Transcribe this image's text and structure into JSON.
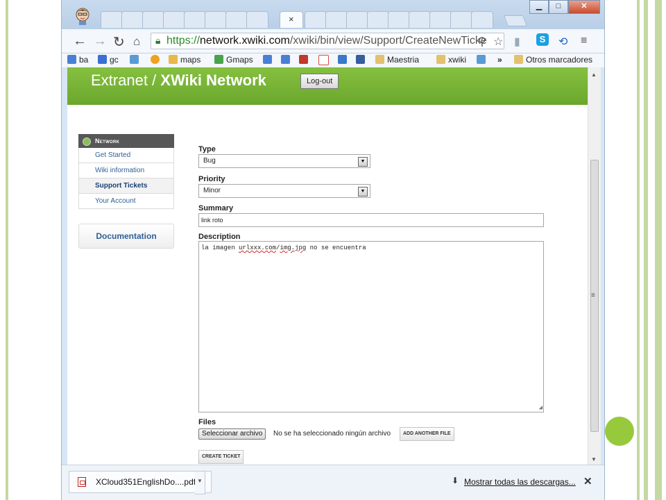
{
  "browser": {
    "url_scheme": "https://",
    "url_host": "network.xwiki.com",
    "url_path": "/xwiki/bin/view/Support/CreateNewTicke",
    "tab_close": "×",
    "window_buttons": {
      "minimize": "▁",
      "maximize": "□",
      "close": "✕"
    }
  },
  "bookmarks": [
    {
      "label": "ba",
      "icon": "google-icon",
      "color": "#4a7fd6"
    },
    {
      "label": "gc",
      "icon": "calendar-icon",
      "color": "#3d6fd1"
    },
    {
      "label": "",
      "icon": "photo-icon",
      "color": "#5b9bd5"
    },
    {
      "label": "",
      "icon": "pie-icon",
      "color": "#f0a020"
    },
    {
      "label": "maps",
      "icon": "maps-icon",
      "color": "#e8b84a"
    },
    {
      "label": "Gmaps",
      "icon": "gmaps-icon",
      "color": "#49a34d"
    },
    {
      "label": "",
      "icon": "translate-icon",
      "color": "#4a7fd6"
    },
    {
      "label": "",
      "icon": "translate2-icon",
      "color": "#4a7fd6"
    },
    {
      "label": "",
      "icon": "plus-icon",
      "color": "#c0392b"
    },
    {
      "label": "",
      "icon": "gmail-icon",
      "color": "#d64c3c"
    },
    {
      "label": "",
      "icon": "windows-icon",
      "color": "#3a78c9"
    },
    {
      "label": "",
      "icon": "fn-icon",
      "color": "#355e9e"
    },
    {
      "label": "Maestria",
      "icon": "folder-icon",
      "color": "#e3c170"
    },
    {
      "label": "xwiki",
      "icon": "folder-icon",
      "color": "#e3c170"
    },
    {
      "label": "",
      "icon": "chart-icon",
      "color": "#5b9bd5"
    },
    {
      "label": "»",
      "icon": "",
      "color": ""
    },
    {
      "label": "Otros marcadores",
      "icon": "folder-icon",
      "color": "#e3c170"
    }
  ],
  "site": {
    "title_prefix": "Extranet / ",
    "title_main": "XWiki Network",
    "logout_label": "Log-out"
  },
  "sidebar": {
    "header": "Network",
    "items": [
      {
        "label": "Get Started",
        "active": false
      },
      {
        "label": "Wiki information",
        "active": false
      },
      {
        "label": "Support Tickets",
        "active": true
      },
      {
        "label": "Your Account",
        "active": false
      }
    ],
    "documentation": "Documentation"
  },
  "form": {
    "type_label": "Type",
    "type_value": "Bug",
    "priority_label": "Priority",
    "priority_value": "Minor",
    "summary_label": "Summary",
    "summary_value": "link roto",
    "description_label": "Description",
    "description_text_1": "la imagen ",
    "description_link_1": "urlxxx.com",
    "description_text_2": "/",
    "description_link_2": "img.jpg",
    "description_text_3": " no se encuentra",
    "files_label": "Files",
    "file_button": "Seleccionar archivo",
    "file_status": "No se ha seleccionado ningún archivo",
    "add_file": "ADD ANOTHER FILE",
    "create_ticket": "CREATE TICKET"
  },
  "downloads": {
    "file_name": "XCloud351EnglishDo....pdf",
    "show_all": "Mostrar todas las descargas..."
  }
}
